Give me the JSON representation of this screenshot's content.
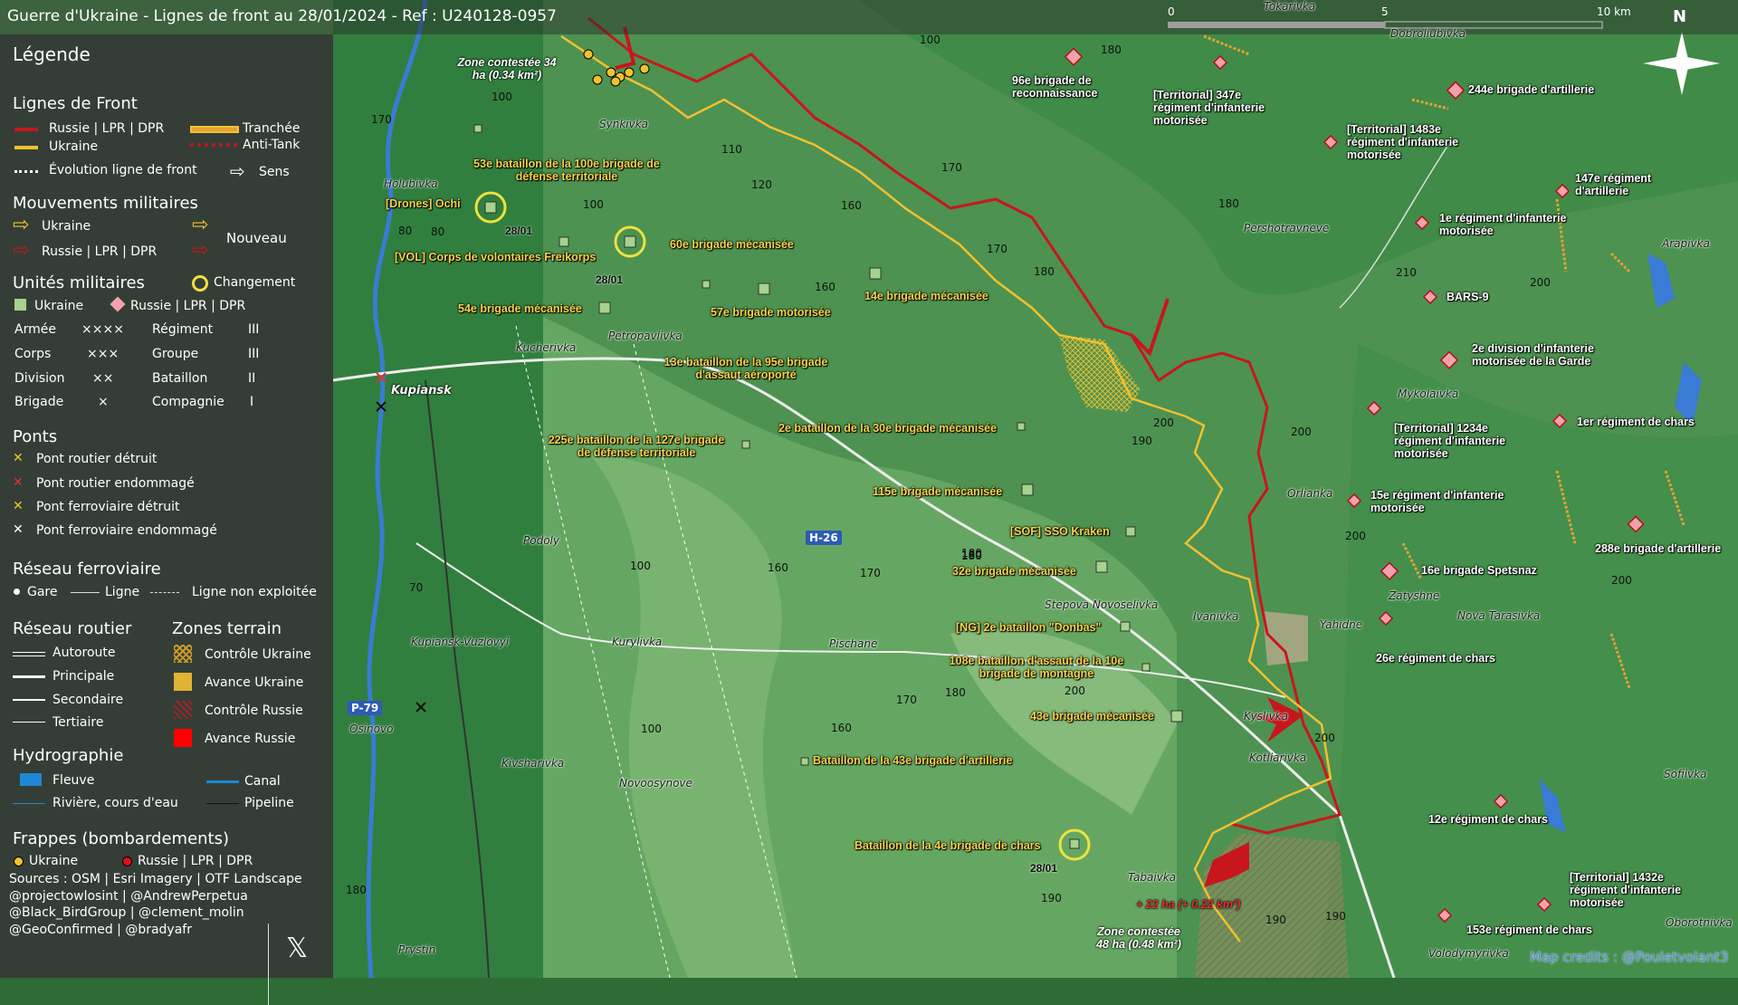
{
  "title": "Guerre d'Ukraine - Lignes de front au 28/01/2024 - Ref : U240128-0957",
  "scale": {
    "marks": [
      "0",
      "5",
      "10 km"
    ]
  },
  "north": "N",
  "credits": "Map credits : @Pouletvolant3",
  "legend": {
    "heading": "Légende",
    "front": {
      "title": "Lignes de Front",
      "russia": "Russie | LPR | DPR",
      "ukraine": "Ukraine",
      "evolution": "Évolution ligne de front",
      "trench": "Tranchée",
      "antitank": "Anti-Tank",
      "direction": "Sens"
    },
    "moves": {
      "title": "Mouvements militaires",
      "ukraine": "Ukraine",
      "russia": "Russie | LPR | DPR",
      "new": "Nouveau"
    },
    "units": {
      "title": "Unités militaires",
      "change": "Changement",
      "ukraine": "Ukraine",
      "russia": "Russie | LPR | DPR",
      "rows": [
        {
          "name": "Armée",
          "sym": "××××",
          "name2": "Régiment",
          "sym2": "III"
        },
        {
          "name": "Corps",
          "sym": "×××",
          "name2": "Groupe",
          "sym2": "III"
        },
        {
          "name": "Division",
          "sym": "××",
          "name2": "Bataillon",
          "sym2": "II"
        },
        {
          "name": "Brigade",
          "sym": "×",
          "name2": "Compagnie",
          "sym2": "I"
        }
      ]
    },
    "bridges": {
      "title": "Ponts",
      "items": [
        "Pont routier détruit",
        "Pont routier endommagé",
        "Pont ferroviaire détruit",
        "Pont ferroviaire endommagé"
      ]
    },
    "rail": {
      "title": "Réseau ferroviaire",
      "station": "Gare",
      "line": "Ligne",
      "unused": "Ligne non exploitée"
    },
    "roads": {
      "title": "Réseau routier",
      "items": [
        "Autoroute",
        "Principale",
        "Secondaire",
        "Tertiaire"
      ]
    },
    "zones": {
      "title": "Zones terrain",
      "items": [
        "Contrôle Ukraine",
        "Avance Ukraine",
        "Contrôle Russie",
        "Avance Russie"
      ]
    },
    "hydro": {
      "title": "Hydrographie",
      "river": "Fleuve",
      "canal": "Canal",
      "stream": "Rivière, cours d'eau",
      "pipeline": "Pipeline"
    },
    "strikes": {
      "title": "Frappes (bombardements)",
      "ukraine": "Ukraine",
      "russia": "Russie | LPR | DPR"
    },
    "sources": [
      "Sources : OSM | Esri Imagery | OTF Landscape",
      "@projectowlosint | @AndrewPerpetua",
      "@Black_BirdGroup | @clement_molin",
      "@GeoConfirmed | @bradyafr"
    ],
    "x_logo": "𝕏"
  },
  "colors": {
    "russia": "#c8161d",
    "ukraine": "#f2c12e",
    "change": "#f0e040",
    "river": "#3a7bd5",
    "terrain_dark": "#1f5a2a",
    "terrain_light": "#9cc78b"
  },
  "ukraine_units": [
    "53e bataillon de la 100e brigade de défense territoriale",
    "[Drones] Ochi",
    "[VOL] Corps de volontaires Freikorps",
    "60e brigade mécanisée",
    "54e brigade mécanisée",
    "57e brigade motorisée",
    "14e brigade mécanisée",
    "13e bataillon de la 95e brigade d'assaut aéroporté",
    "225e bataillon de la 127e brigade de défense territoriale",
    "2e bataillon de la 30e brigade mécanisée",
    "115e brigade mécanisée",
    "[SOF] SSO Kraken",
    "32e brigade mécanisée",
    "[NG] 2e bataillon \"Donbas\"",
    "108e bataillon d'assaut de la 10e brigade de montagne",
    "43e brigade mécanisée",
    "Bataillon de la 43e brigade d'artillerie",
    "Bataillon de la 4e brigade de chars"
  ],
  "russia_units": [
    "96e brigade de reconnaissance",
    "[Territorial] 347e régiment d'infanterie motorisée",
    "244e brigade d'artillerie",
    "[Territorial] 1483e régiment d'infanterie motorisée",
    "147e régiment d'artillerie",
    "1e régiment d'infanterie motorisée",
    "BARS-9",
    "2e division d'infanterie motorisée de la Garde",
    "[Territorial] 1234e régiment d'infanterie motorisée",
    "1er régiment de chars",
    "15e régiment d'infanterie motorisée",
    "288e brigade d'artillerie",
    "16e brigade Spetsnaz",
    "26e régiment de chars",
    "12e régiment de chars",
    "[Territorial] 1432e régiment d'infanterie motorisée",
    "153e régiment de chars"
  ],
  "zones": [
    "Zone contestée 34 ha (0.34 km²)",
    "Zone contestée 48 ha (0.48 km²)",
    "+ 22 ha (+ 0.22 km²)"
  ],
  "towns": [
    "Synkivka",
    "Holubivka",
    "Petropavlivka",
    "Kucherivka",
    "Kupiansk",
    "Podoly",
    "Kupiansk-Vuzlovyi",
    "Kurylivka",
    "Osinovo",
    "Kivsharivka",
    "Novoosynove",
    "Prystin",
    "Pischane",
    "Stepova Novoselivka",
    "Ivanivka",
    "Kyslivka",
    "Kotliarivka",
    "Tabaivka",
    "Orlianka",
    "Mykolaivka",
    "Pershotravneve",
    "Yahidne",
    "Zatyshne",
    "Nova Tarasivka",
    "Arapivka",
    "Sofiivka",
    "Oborotnivka",
    "Volodymyrivka",
    "Tokarivka",
    "Dobroliubivka"
  ],
  "dates": [
    "28/01",
    "28/01",
    "28/01"
  ],
  "altitudes": [
    "100",
    "170",
    "80",
    "110",
    "100",
    "120",
    "160",
    "170",
    "180",
    "100",
    "80",
    "160",
    "170",
    "100",
    "180",
    "160",
    "170",
    "180",
    "200",
    "200",
    "190",
    "200",
    "200",
    "190",
    "190",
    "70",
    "200",
    "170",
    "180",
    "160",
    "180",
    "180",
    "210",
    "200",
    "200",
    "190",
    "180",
    "100",
    "180"
  ],
  "roads": [
    "H-26",
    "P-79"
  ]
}
